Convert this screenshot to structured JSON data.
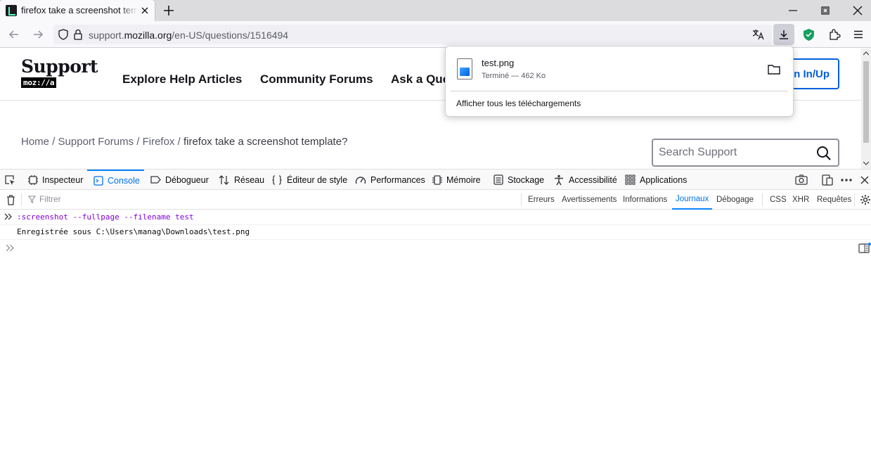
{
  "tab": {
    "title": "firefox take a screenshot template?"
  },
  "nav": {
    "url_domain_prefix": "support.",
    "url_domain_main": "mozilla.org",
    "url_path": "/en-US/questions/1516494"
  },
  "site": {
    "logo_word": "Support",
    "logo_moz": "moz://a",
    "nav_items": [
      "Explore Help Articles",
      "Community Forums",
      "Ask a Question"
    ],
    "signin_label": "Sign In/Up",
    "breadcrumb": [
      "Home",
      "Support Forums",
      "Firefox",
      "firefox take a screenshot template?"
    ],
    "search_placeholder": "Search Support"
  },
  "downloads": {
    "file_name": "test.png",
    "file_status": "Terminé — 462 Ko",
    "show_all": "Afficher tous les téléchargements"
  },
  "devtools": {
    "tabs": [
      "Inspecteur",
      "Console",
      "Débogueur",
      "Réseau",
      "Éditeur de style",
      "Performances",
      "Mémoire",
      "Stockage",
      "Accessibilité",
      "Applications"
    ],
    "active_tab": "Console",
    "filter_placeholder": "Filtrer",
    "levels": [
      "Erreurs",
      "Avertissements",
      "Informations",
      "Journaux",
      "Débogage"
    ],
    "active_level": "Journaux",
    "extra_filters": [
      "CSS",
      "XHR",
      "Requêtes"
    ],
    "console": {
      "command": ":screenshot --fullpage --filename test",
      "output": "Enregistrée sous C:\\Users\\manag\\Downloads\\test.png"
    }
  },
  "colors": {
    "accent": "#0a84ff",
    "link": "#0060df",
    "command": "#8000d7"
  }
}
